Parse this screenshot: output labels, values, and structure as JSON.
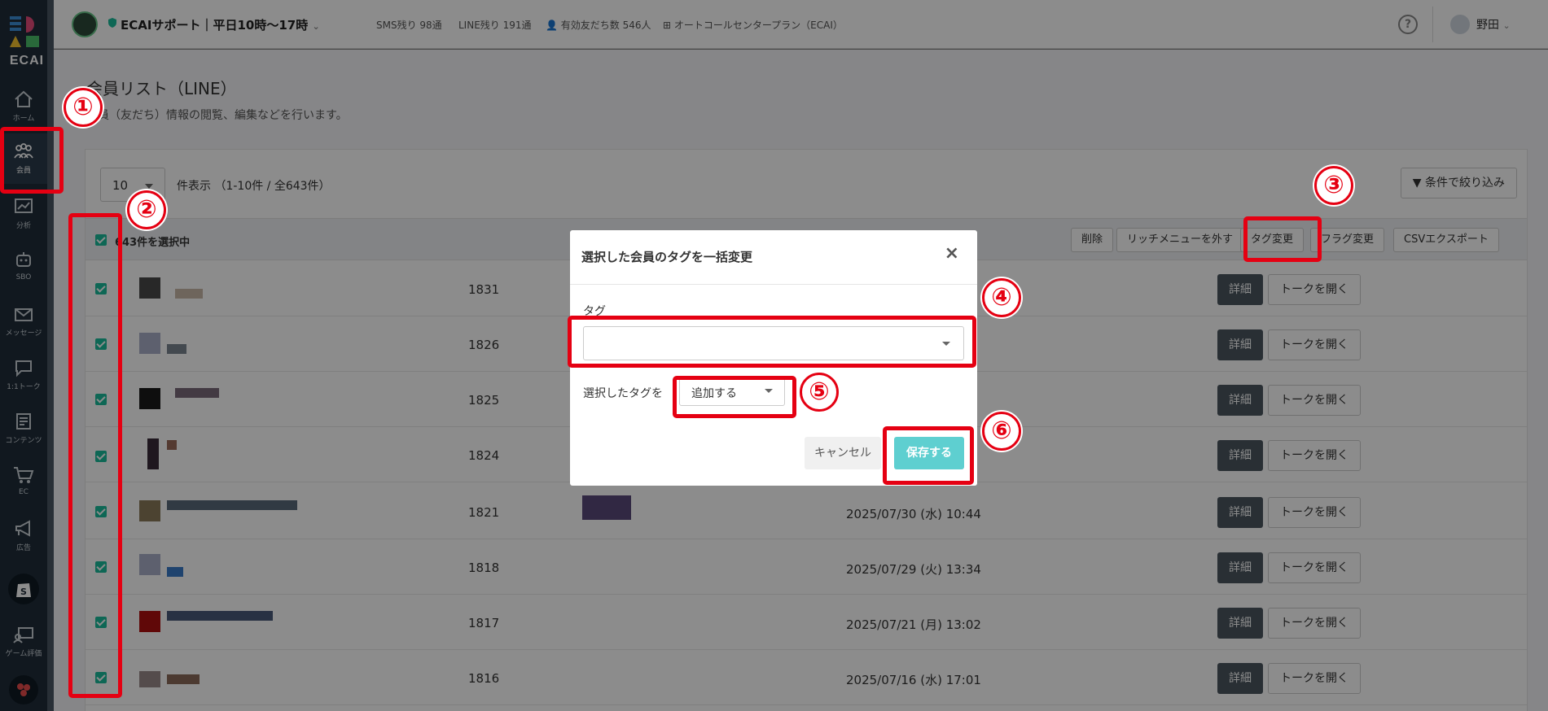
{
  "sidebar": {
    "logo_text": "ECAI",
    "items": [
      {
        "label": "ホーム",
        "icon": "home-icon"
      },
      {
        "label": "会員",
        "icon": "members-icon"
      },
      {
        "label": "分析",
        "icon": "analytics-icon"
      },
      {
        "label": "SBO",
        "icon": "robot-icon"
      },
      {
        "label": "メッセージ",
        "icon": "mail-icon"
      },
      {
        "label": "1:1トーク",
        "icon": "chat-icon"
      },
      {
        "label": "コンテンツ",
        "icon": "content-icon"
      },
      {
        "label": "EC",
        "icon": "cart-icon"
      },
      {
        "label": "広告",
        "icon": "megaphone-icon"
      },
      {
        "label": "",
        "icon": "shopify-icon"
      },
      {
        "label": "ゲーム評価",
        "icon": "game-icon"
      },
      {
        "label": "",
        "icon": "app-icon"
      }
    ]
  },
  "header": {
    "account_name": "ECAIサポート｜平日10時〜17時",
    "sms_remaining": "SMS残り 98通",
    "line_remaining": "LINE残り 191通",
    "valid_friends": "有効友だち数 546人",
    "plan": "オートコールセンタープラン（ECAI）",
    "help": "?",
    "user_name": "野田"
  },
  "page": {
    "title": "会員リスト（LINE）",
    "description": "会員（友だち）情報の閲覧、編集などを行います。"
  },
  "list": {
    "per_page": "10",
    "count_text": "件表示 （1-10件 / 全643件）",
    "filter_button": "条件で絞り込み",
    "selection_text": "643件を選択中",
    "toolbar_buttons": [
      "削除",
      "リッチメニューを外す",
      "タグ変更",
      "フラグ変更",
      "CSVエクスポート"
    ],
    "detail_label": "詳細",
    "talk_label": "トークを開く",
    "rows": [
      {
        "id": "1831",
        "date": ""
      },
      {
        "id": "1826",
        "date": ""
      },
      {
        "id": "1825",
        "date": ""
      },
      {
        "id": "1824",
        "date": ""
      },
      {
        "id": "1821",
        "date": "2025/07/30 (水) 10:44"
      },
      {
        "id": "1818",
        "date": "2025/07/29 (火) 13:34"
      },
      {
        "id": "1817",
        "date": "2025/07/21 (月) 13:02"
      },
      {
        "id": "1816",
        "date": "2025/07/16 (水) 17:01"
      }
    ]
  },
  "modal": {
    "title": "選択した会員のタグを一括変更",
    "close": "×",
    "tag_label": "タグ",
    "tag_value": "",
    "mode_label": "選択したタグを",
    "mode_value": "追加する",
    "cancel_button": "キャンセル",
    "save_button": "保存する"
  },
  "annotations": [
    "①",
    "②",
    "③",
    "④",
    "⑤",
    "⑥"
  ],
  "colors": {
    "sidebar_bg": "#1f2d3a",
    "accent": "#1bbc9b",
    "save_button": "#5ecfd0",
    "annotation_red": "#e50012"
  }
}
